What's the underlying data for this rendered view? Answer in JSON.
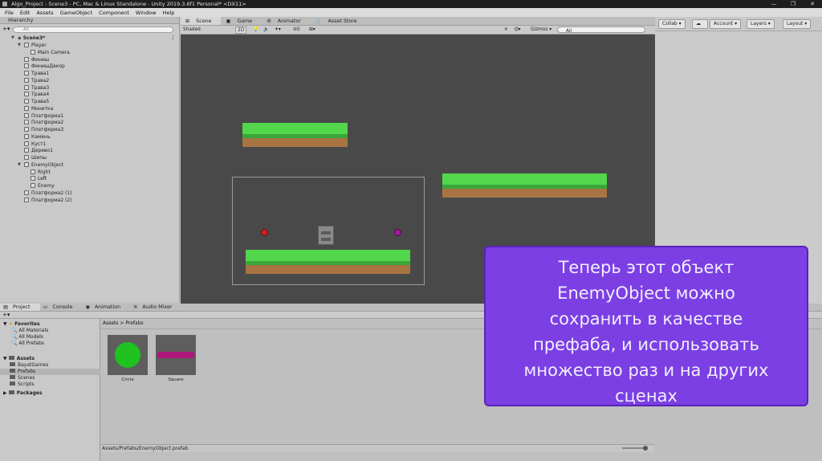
{
  "window": {
    "title": "Algo_Project - Scene3 - PC, Mac & Linux Standalone - Unity 2019.3.6f1 Personal* <DX11>"
  },
  "menu": [
    "File",
    "Edit",
    "Assets",
    "GameObject",
    "Component",
    "Window",
    "Help"
  ],
  "toolbar": {
    "collab": "Collab ▾",
    "account": "Account ▾",
    "layers": "Layers ▾",
    "layout": "Layout ▾"
  },
  "hierarchy": {
    "title": "Hierarchy",
    "search_placeholder": "All",
    "scene": "Scene3*",
    "items": [
      {
        "label": "Player"
      },
      {
        "label": "Main Camera"
      },
      {
        "label": "Финиш"
      },
      {
        "label": "ФинишДекор"
      },
      {
        "label": "Трава1"
      },
      {
        "label": "Трава2"
      },
      {
        "label": "Трава3"
      },
      {
        "label": "Трава4"
      },
      {
        "label": "Трава5"
      },
      {
        "label": "Монетка"
      },
      {
        "label": "Платформа1"
      },
      {
        "label": "Платформа2"
      },
      {
        "label": "Платформа3"
      },
      {
        "label": "Камень"
      },
      {
        "label": "Куст1"
      },
      {
        "label": "Дерево1"
      },
      {
        "label": "Шипы"
      },
      {
        "label": "EnemyObject"
      },
      {
        "label": "Right"
      },
      {
        "label": "Left"
      },
      {
        "label": "Enemy"
      },
      {
        "label": "Платформа2 (1)"
      },
      {
        "label": "Платформа2 (2)"
      }
    ]
  },
  "scene_view": {
    "tabs": [
      "Scene",
      "Game",
      "Animator",
      "Asset Store"
    ],
    "shading": "Shaded",
    "mode_2d": "2D",
    "gizmos": "Gizmos ▾",
    "search_placeholder": "All"
  },
  "bottom": {
    "tabs": [
      "Project",
      "Console",
      "Animation",
      "Audio Mixer"
    ],
    "favorites": {
      "title": "Favorites",
      "items": [
        "All Materials",
        "All Models",
        "All Prefabs"
      ]
    },
    "assets": {
      "title": "Assets",
      "items": [
        "BayatGames",
        "Prefabs",
        "Scenes",
        "Scripts"
      ]
    },
    "packages": "Packages",
    "breadcrumb": "Assets > Prefabs",
    "prefabs": [
      {
        "label": "Circle"
      },
      {
        "label": "Square"
      }
    ],
    "path": "Assets/Prefabs/EnemyObject.prefab"
  },
  "callout": {
    "lines": [
      "Теперь этот объект",
      "EnemyObject можно",
      "сохранить в качестве",
      "префаба, и использовать",
      "множество раз и на других",
      "сценах"
    ]
  },
  "colors": {
    "callout_bg": "#7b3fe4",
    "grass": "#52d64b",
    "dirt": "#a87443",
    "scene_bg": "#494949",
    "circle_prefab": "#1fc21f",
    "square_prefab": "#b0177d"
  }
}
